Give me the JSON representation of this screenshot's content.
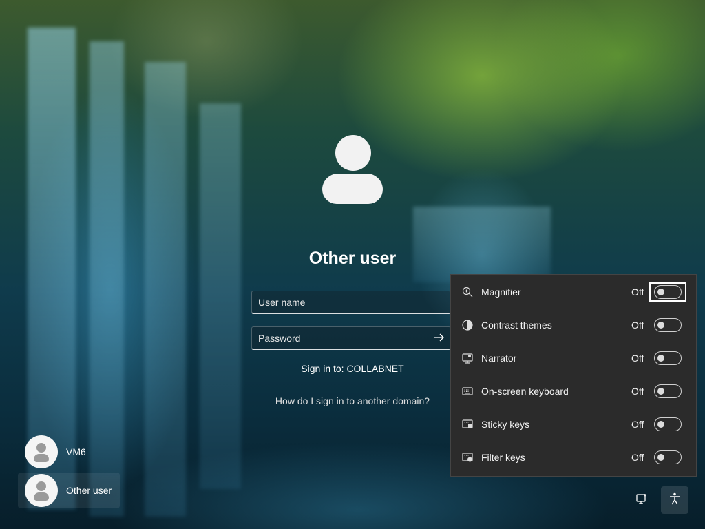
{
  "login": {
    "user_title": "Other user",
    "username_placeholder": "User name",
    "password_placeholder": "Password",
    "submit_icon": "arrow-right-icon",
    "signin_to": "Sign in to: COLLABNET",
    "other_domain_link": "How do I sign in to another domain?"
  },
  "users": [
    {
      "name": "VM6",
      "selected": false
    },
    {
      "name": "Other user",
      "selected": true
    }
  ],
  "accessibility": {
    "items": [
      {
        "label": "Magnifier",
        "state": "Off",
        "icon": "magnifier-icon"
      },
      {
        "label": "Contrast themes",
        "state": "Off",
        "icon": "contrast-icon"
      },
      {
        "label": "Narrator",
        "state": "Off",
        "icon": "narrator-icon"
      },
      {
        "label": "On-screen keyboard",
        "state": "Off",
        "icon": "keyboard-icon"
      },
      {
        "label": "Sticky keys",
        "state": "Off",
        "icon": "sticky-keys-icon"
      },
      {
        "label": "Filter keys",
        "state": "Off",
        "icon": "filter-keys-icon"
      }
    ]
  },
  "bottom_buttons": [
    {
      "icon": "network-icon"
    },
    {
      "icon": "accessibility-icon",
      "active": true
    }
  ]
}
